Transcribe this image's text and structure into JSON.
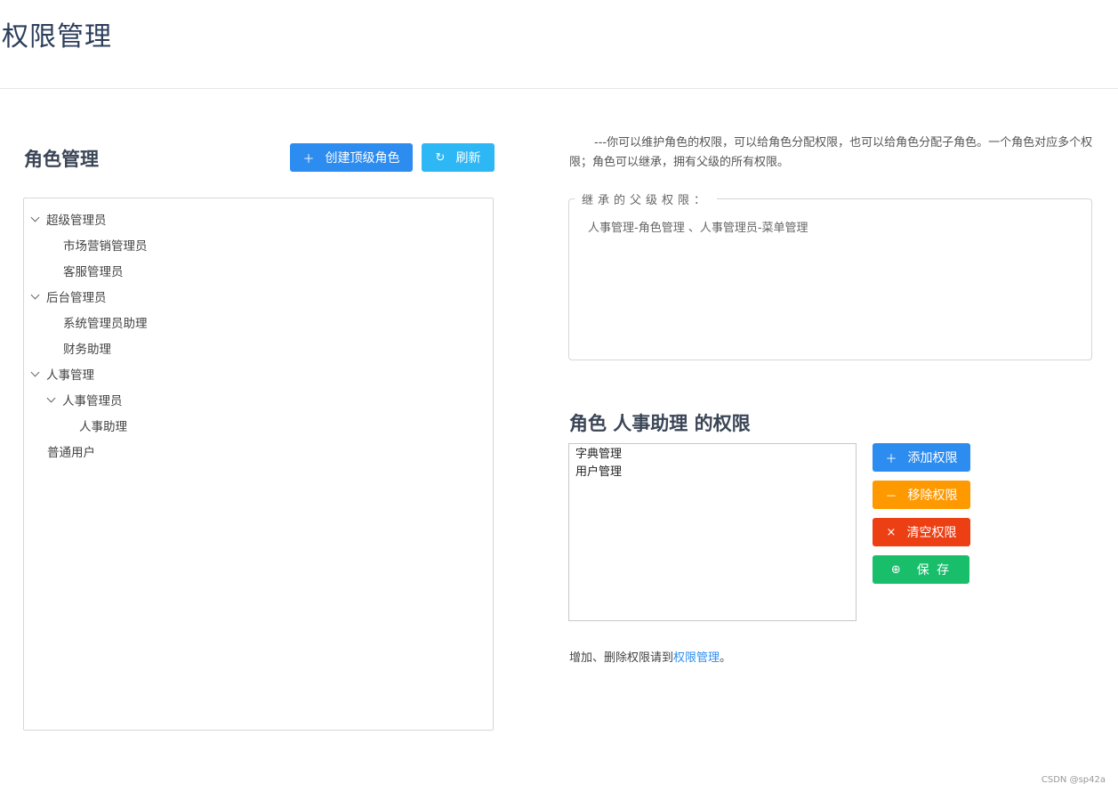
{
  "page": {
    "title": "权限管理"
  },
  "role_panel": {
    "title": "角色管理",
    "create_button": "创建顶级角色",
    "refresh_button": "刷新"
  },
  "tree": [
    {
      "label": "超级管理员",
      "expanded": true,
      "level": 0
    },
    {
      "label": "市场营销管理员",
      "level": 1
    },
    {
      "label": "客服管理员",
      "level": 1
    },
    {
      "label": "后台管理员",
      "expanded": true,
      "level": 0
    },
    {
      "label": "系统管理员助理",
      "level": 1
    },
    {
      "label": "财务助理",
      "level": 1
    },
    {
      "label": "人事管理",
      "expanded": true,
      "level": 0
    },
    {
      "label": "人事管理员",
      "expanded": true,
      "level": 1
    },
    {
      "label": "人事助理",
      "level": 2
    },
    {
      "label": "普通用户",
      "level": 0
    }
  ],
  "description": "---你可以维护角色的权限，可以给角色分配权限，也可以给角色分配子角色。一个角色对应多个权限；角色可以继承，拥有父级的所有权限。",
  "inherited": {
    "legend": "继承的父级权限：",
    "value": "人事管理-角色管理 、人事管理员-菜单管理"
  },
  "role_permissions": {
    "title": "角色 人事助理 的权限",
    "items": [
      "字典管理",
      "用户管理"
    ],
    "add_button": "添加权限",
    "remove_button": "移除权限",
    "clear_button": "清空权限",
    "save_button": "保 存"
  },
  "footnote": {
    "prefix": "增加、删除权限请到",
    "link": "权限管理",
    "suffix": "。"
  },
  "watermark": "CSDN @sp42a",
  "colors": {
    "primary": "#2d8cf0",
    "info": "#2db7f5",
    "warning": "#ff9900",
    "error": "#ed3f14",
    "success": "#19be6b",
    "title": "#2c3e5c"
  }
}
